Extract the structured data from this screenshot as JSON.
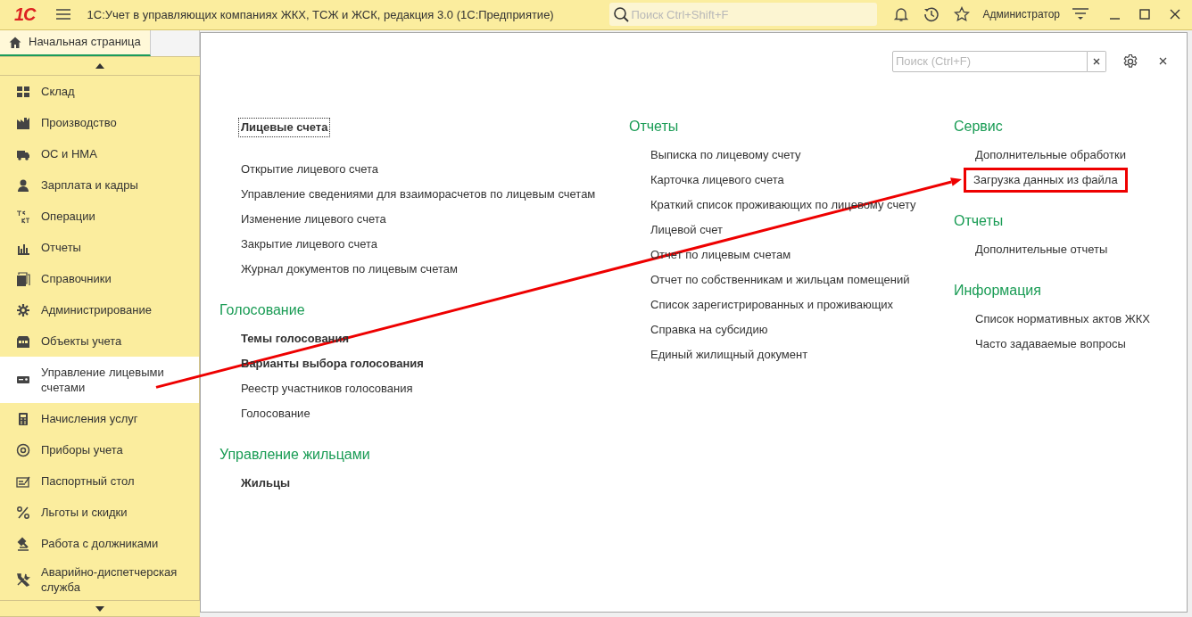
{
  "window": {
    "logo": "1С",
    "title": "1С:Учет в управляющих компаниях ЖКХ, ТСЖ и ЖСК, редакция 3.0  (1С:Предприятие)",
    "search": {
      "placeholder": "Поиск Ctrl+Shift+F"
    },
    "user": "Администратор"
  },
  "home_tab": {
    "label": "Начальная страница",
    "selected": true
  },
  "sidebar": {
    "items": [
      {
        "label": "Склад",
        "selected": false
      },
      {
        "label": "Производство",
        "selected": false
      },
      {
        "label": "ОС и НМА",
        "selected": false
      },
      {
        "label": "Зарплата и кадры",
        "selected": false
      },
      {
        "label": "Операции",
        "selected": false
      },
      {
        "label": "Отчеты",
        "selected": false
      },
      {
        "label": "Справочники",
        "selected": false
      },
      {
        "label": "Администрирование",
        "selected": false
      },
      {
        "label": "Объекты учета",
        "selected": false
      },
      {
        "label": "Управление лицевыми счетами",
        "selected": true
      },
      {
        "label": "Начисления услуг",
        "selected": false
      },
      {
        "label": "Приборы учета",
        "selected": false
      },
      {
        "label": "Паспортный стол",
        "selected": false
      },
      {
        "label": "Льготы и скидки",
        "selected": false
      },
      {
        "label": "Работа с должниками",
        "selected": false
      },
      {
        "label": "Аварийно-диспетчерская служба",
        "selected": false
      }
    ]
  },
  "panel": {
    "search": {
      "placeholder": "Поиск (Ctrl+F)"
    },
    "columns": [
      [
        {
          "items": [
            {
              "label": "Лицевые счета",
              "important": true,
              "focused": true,
              "highlighted": false
            }
          ]
        },
        {
          "items": [
            {
              "label": "Открытие лицевого счета",
              "important": false,
              "focused": false,
              "highlighted": false
            },
            {
              "label": "Управление сведениями для взаиморасчетов по лицевым счетам",
              "important": false,
              "focused": false,
              "highlighted": false
            },
            {
              "label": "Изменение лицевого счета",
              "important": false,
              "focused": false,
              "highlighted": false
            },
            {
              "label": "Закрытие лицевого счета",
              "important": false,
              "focused": false,
              "highlighted": false
            },
            {
              "label": "Журнал документов по лицевым счетам",
              "important": false,
              "focused": false,
              "highlighted": false
            }
          ]
        },
        {
          "heading": "Голосование",
          "items": [
            {
              "label": "Темы голосования",
              "important": true,
              "focused": false,
              "highlighted": false
            },
            {
              "label": "Варианты выбора голосования",
              "important": true,
              "focused": false,
              "highlighted": false
            },
            {
              "label": "Реестр участников голосования",
              "important": false,
              "focused": false,
              "highlighted": false
            },
            {
              "label": "Голосование",
              "important": false,
              "focused": false,
              "highlighted": false
            }
          ]
        },
        {
          "heading": "Управление жильцами",
          "items": [
            {
              "label": "Жильцы",
              "important": true,
              "focused": false,
              "highlighted": false
            }
          ]
        }
      ],
      [
        {
          "heading": "Отчеты",
          "items": [
            {
              "label": "Выписка по лицевому счету",
              "important": false,
              "focused": false,
              "highlighted": false
            },
            {
              "label": "Карточка лицевого счета",
              "important": false,
              "focused": false,
              "highlighted": false
            },
            {
              "label": "Краткий список проживающих по лицевому счету",
              "important": false,
              "focused": false,
              "highlighted": false
            },
            {
              "label": "Лицевой счет",
              "important": false,
              "focused": false,
              "highlighted": false
            },
            {
              "label": "Отчет по лицевым счетам",
              "important": false,
              "focused": false,
              "highlighted": false
            },
            {
              "label": "Отчет по собственникам и жильцам помещений",
              "important": false,
              "focused": false,
              "highlighted": false
            },
            {
              "label": "Список зарегистрированных и проживающих",
              "important": false,
              "focused": false,
              "highlighted": false
            },
            {
              "label": "Справка на субсидию",
              "important": false,
              "focused": false,
              "highlighted": false
            },
            {
              "label": "Единый жилищный документ",
              "important": false,
              "focused": false,
              "highlighted": false
            }
          ]
        }
      ],
      [
        {
          "heading": "Сервис",
          "items": [
            {
              "label": "Дополнительные обработки",
              "important": false,
              "focused": false,
              "highlighted": false
            },
            {
              "label": "Загрузка данных из файла",
              "important": false,
              "focused": false,
              "highlighted": true
            }
          ]
        },
        {
          "heading": "Отчеты",
          "items": [
            {
              "label": "Дополнительные отчеты",
              "important": false,
              "focused": false,
              "highlighted": false
            }
          ]
        },
        {
          "heading": "Информация",
          "items": [
            {
              "label": "Список нормативных актов ЖКХ",
              "important": false,
              "focused": false,
              "highlighted": false
            },
            {
              "label": "Часто задаваемые вопросы",
              "important": false,
              "focused": false,
              "highlighted": false
            }
          ]
        }
      ]
    ]
  },
  "annotation": {
    "arrow": true
  }
}
